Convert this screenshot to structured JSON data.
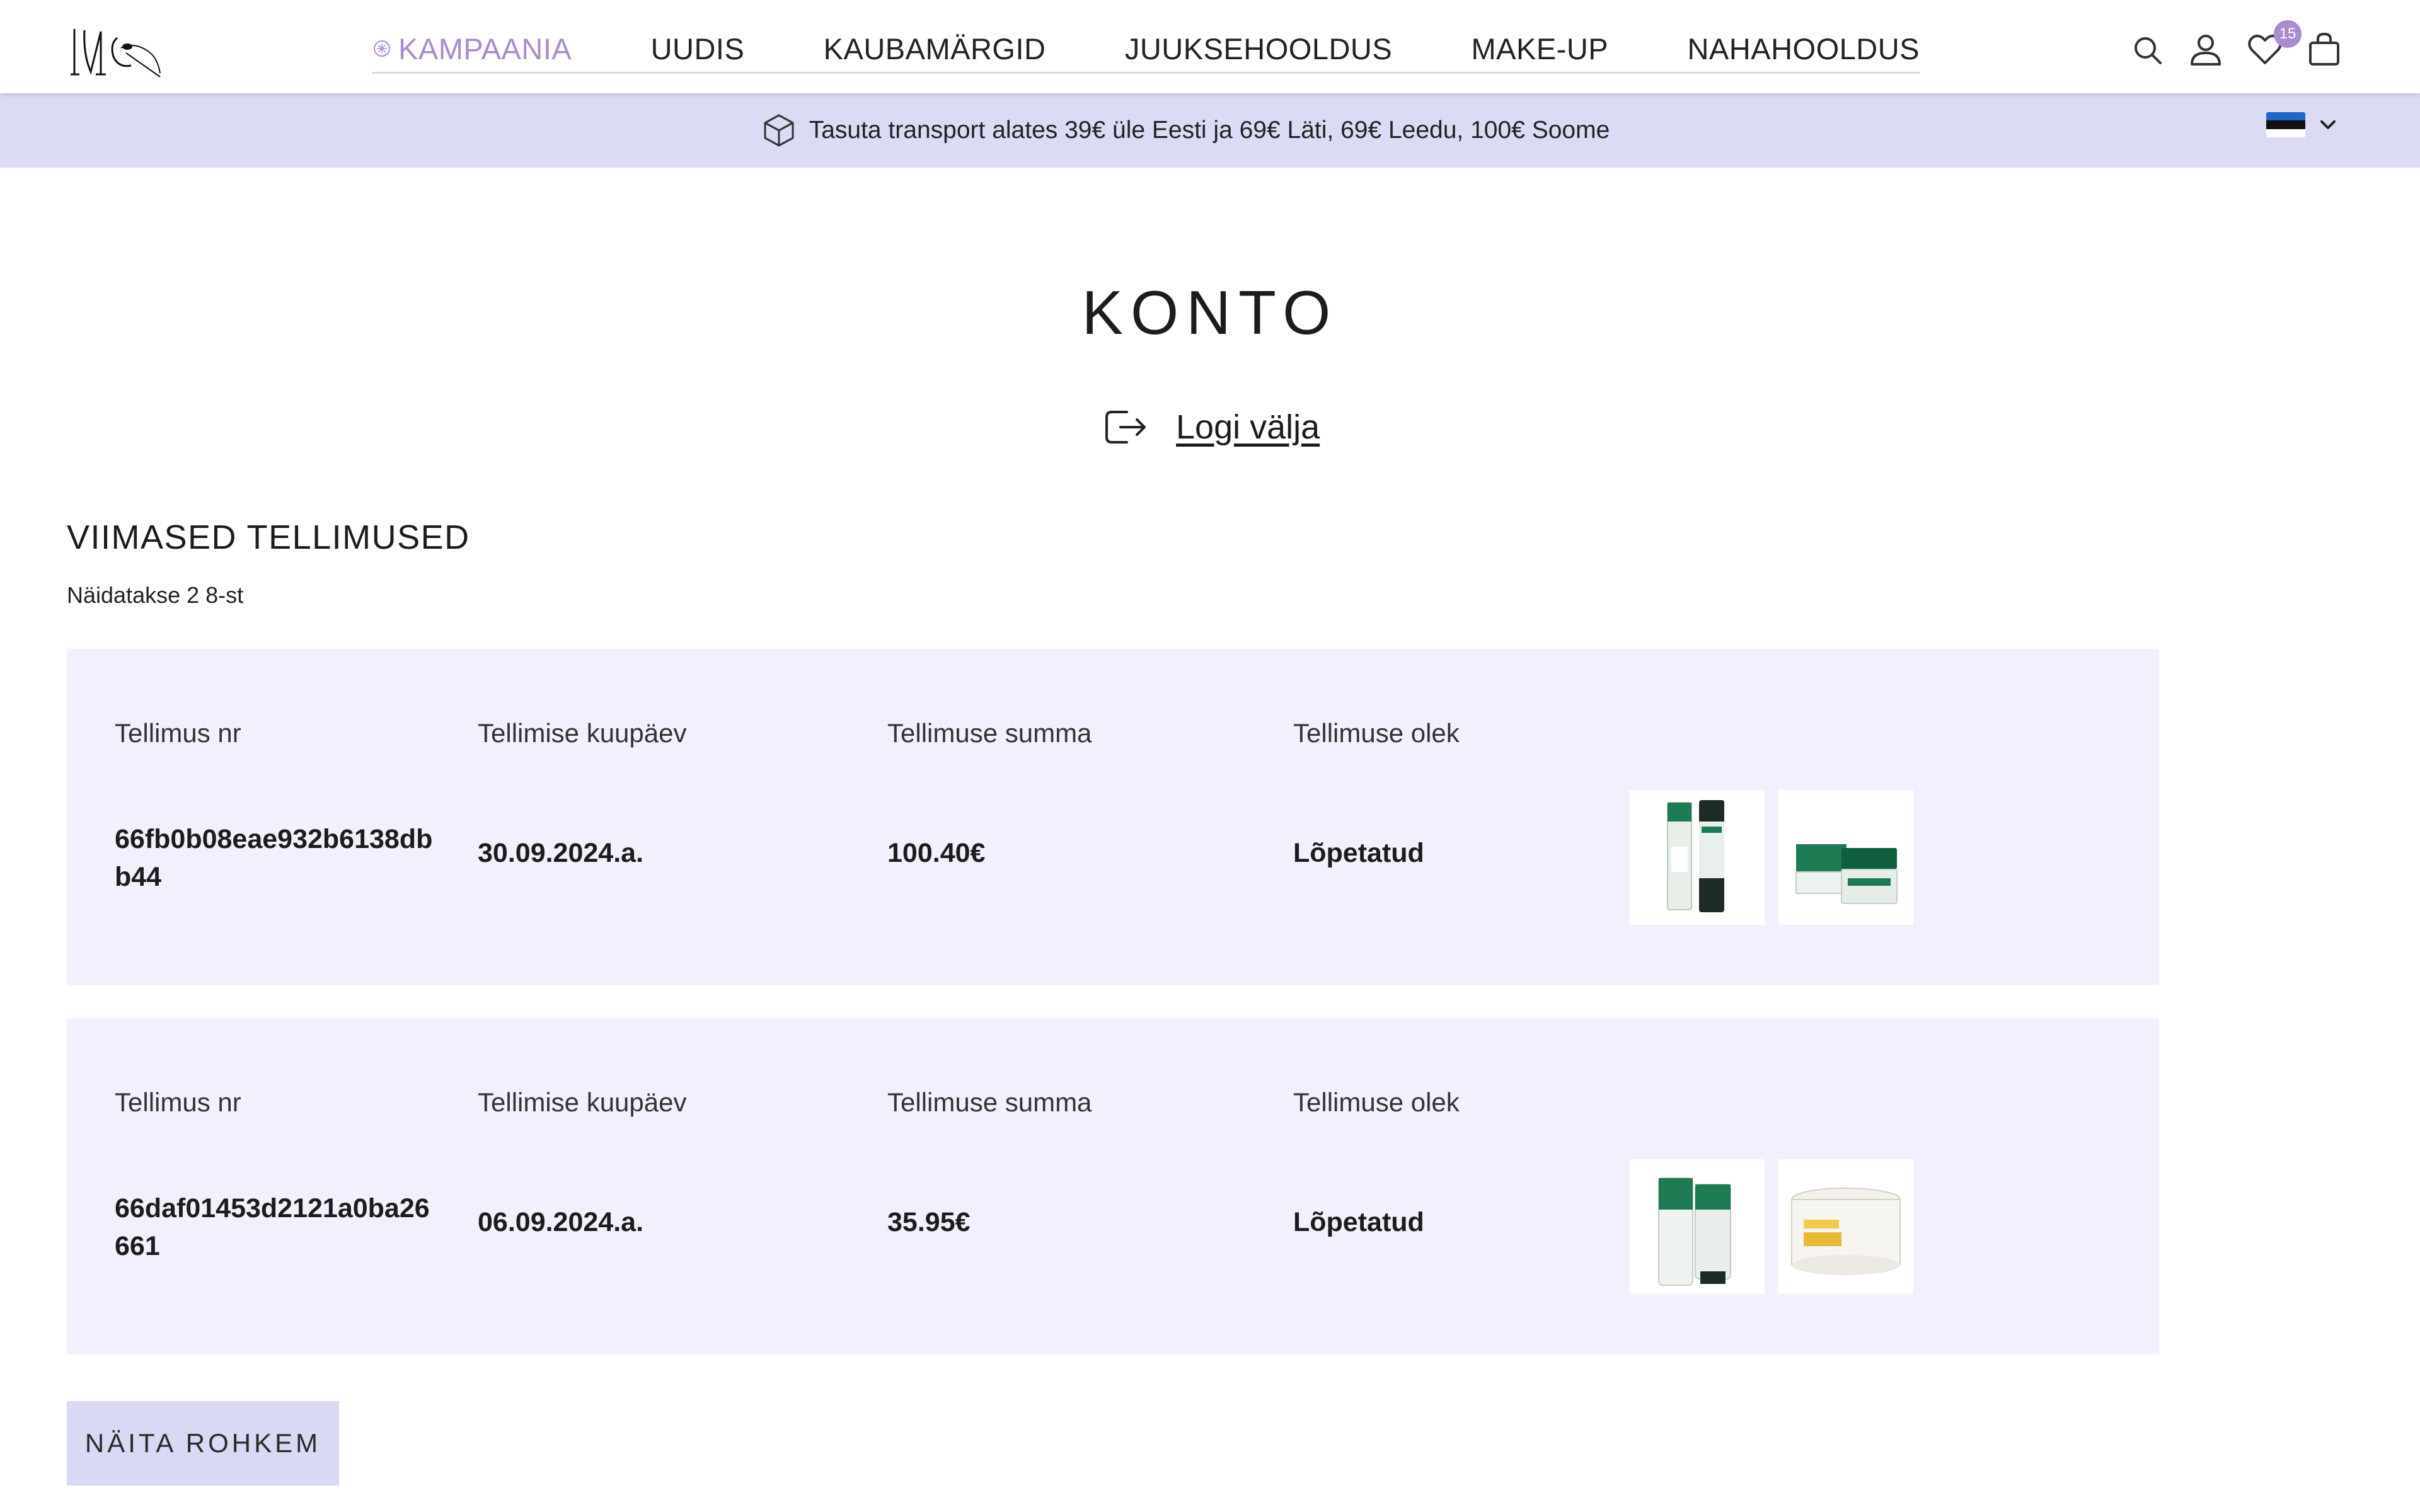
{
  "header": {
    "logo_icon": "brand-logo-icon",
    "nav": [
      {
        "label": "KAMPAANIA",
        "icon": "sparkle-icon"
      },
      {
        "label": "UUDIS"
      },
      {
        "label": "KAUBAMÄRGID"
      },
      {
        "label": "JUUKSEHOOLDUS"
      },
      {
        "label": "MAKE-UP"
      },
      {
        "label": "NAHAHOOLDUS"
      }
    ],
    "icons": [
      "search-icon",
      "user-icon",
      "heart-icon",
      "bag-icon"
    ],
    "wishlist_count": "15",
    "promo_color": "#a98ccc"
  },
  "banner": {
    "icon": "box-icon",
    "text": "Tasuta transport alates 39€ üle Eesti ja 69€ Läti, 69€ Leedu, 100€ Soome",
    "language_flag": "estonia-flag",
    "background": "#dcdbf6"
  },
  "page": {
    "title": "KONTO",
    "logout_label": "Logi välja"
  },
  "orders_section": {
    "title": "VIIMASED TELLIMUSED",
    "showing": "Näidatakse 2 8-st",
    "columns": {
      "number": "Tellimus nr",
      "date": "Tellimise kuupäev",
      "total": "Tellimuse summa",
      "status": "Tellimuse olek"
    },
    "orders": [
      {
        "number": "66fb0b08eae932b6138dbb44",
        "date": "30.09.2024.a.",
        "total": "100.40€",
        "status": "Lõpetatud",
        "products": [
          "green-toner-bottle",
          "green-cream-jars"
        ]
      },
      {
        "number": "66daf01453d2121a0ba26661",
        "date": "06.09.2024.a.",
        "total": "35.95€",
        "status": "Lõpetatud",
        "products": [
          "green-cleanser-tubes",
          "vitamin-pads-jar"
        ]
      }
    ],
    "more_label": "NÄITA ROHKEM"
  }
}
